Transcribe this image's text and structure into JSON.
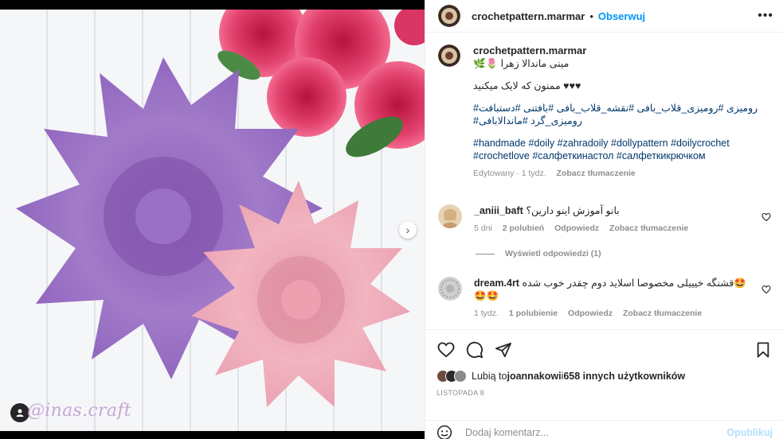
{
  "post": {
    "author": "crochetpattern.marmar",
    "follow_label": "Obserwuj",
    "more_label": "•••",
    "watermark": "@inas.craft"
  },
  "caption": {
    "line1": "مینی ماندالا زهرا 🌷🌿",
    "line2": "♥♥♥ ممنون که لایک میکنید",
    "hashtags_fa_1": "رومیزی #رومیزی_قلاب_بافی #نقشه_قلاب_بافی #بافتنی #دستبافت#",
    "hashtags_fa_2": "رومیزی_گرد #ماندالابافی#",
    "hashtags_en_1": "#handmade #doily #zahradoily #dollypattern #doilycrochet",
    "hashtags_en_2": "#crochetlove #салфеткинастол #салфеткикрючком",
    "edited": "Edytowany · 1 tydz.",
    "see_translation": "Zobacz tłumaczenie"
  },
  "comments": [
    {
      "user": "_aniii_baft",
      "text": "بانو آموزش اینو دارین؟",
      "time": "5 dni",
      "likes": "2 polubień",
      "reply": "Odpowiedz",
      "translate": "Zobacz tłumaczenie",
      "replies_label": "Wyświetl odpowiedzi (1)"
    },
    {
      "user": "dream.4rt",
      "text": "🤩قشنگه خیییلی مخصوصا اسلاید دوم چقدر خوب شده",
      "text2": "🤩🤩",
      "time": "1 tydz.",
      "likes": "1 polubienie",
      "reply": "Odpowiedz",
      "translate": "Zobacz tłumaczenie"
    }
  ],
  "likes": {
    "prefix": "Lubią to ",
    "user": "joannakowi",
    "middle": " i ",
    "others": "658 innych użytkowników"
  },
  "date": "LISTOPADA 8",
  "composer": {
    "placeholder": "Dodaj komentarz...",
    "post_label": "Opublikuj"
  },
  "colors": {
    "accent": "#0095f6",
    "link": "#00376b",
    "muted": "#8e8e8e"
  },
  "icons": [
    "heart-icon",
    "comment-icon",
    "share-icon",
    "bookmark-icon",
    "emoji-icon",
    "more-icon",
    "user-tag-icon",
    "chevron-right-icon"
  ]
}
